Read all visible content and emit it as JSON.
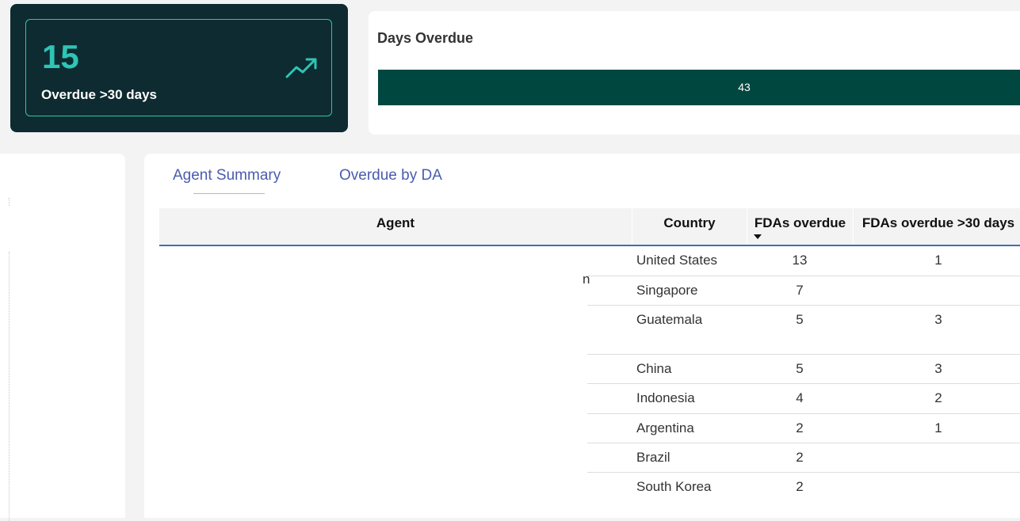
{
  "kpi": {
    "value": "15",
    "label": "Overdue >30 days",
    "trend_icon": "trending-up-icon",
    "accent": "#2ec4b6"
  },
  "days_overdue": {
    "title": "Days Overdue",
    "bar_value": "43",
    "bar_color": "#00473f"
  },
  "tabs": [
    {
      "label": "Agent Summary",
      "active": true
    },
    {
      "label": "Overdue by DA",
      "active": false
    }
  ],
  "table": {
    "headers": {
      "agent": "Agent",
      "country": "Country",
      "fdas_overdue": "FDAs overdue",
      "fdas_overdue_30": "FDAs overdue >30 days"
    },
    "clipped_agent_text": "n",
    "rows": [
      {
        "country": "United States",
        "fdas_overdue": "13",
        "fdas_overdue_30": "1"
      },
      {
        "country": "Singapore",
        "fdas_overdue": "7",
        "fdas_overdue_30": ""
      },
      {
        "country": "Guatemala",
        "fdas_overdue": "5",
        "fdas_overdue_30": "3"
      },
      {
        "country": "China",
        "fdas_overdue": "5",
        "fdas_overdue_30": "3"
      },
      {
        "country": "Indonesia",
        "fdas_overdue": "4",
        "fdas_overdue_30": "2"
      },
      {
        "country": "Argentina",
        "fdas_overdue": "2",
        "fdas_overdue_30": "1"
      },
      {
        "country": "Brazil",
        "fdas_overdue": "2",
        "fdas_overdue_30": ""
      },
      {
        "country": "South Korea",
        "fdas_overdue": "2",
        "fdas_overdue_30": ""
      }
    ]
  }
}
